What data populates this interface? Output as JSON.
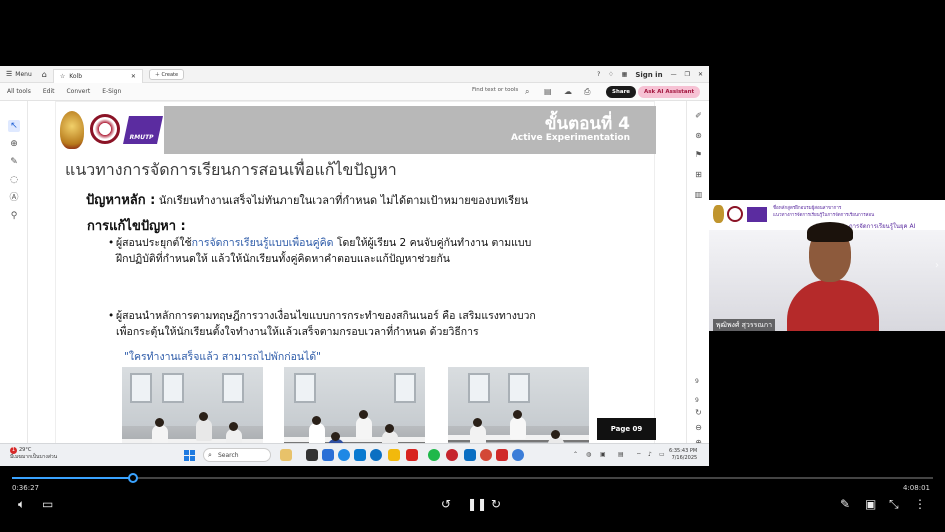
{
  "acrobat": {
    "menu_label": "Menu",
    "tab_title": "Kolb",
    "create_label": "Create",
    "sign_in": "Sign in",
    "toolbar_items": [
      "All tools",
      "Edit",
      "Convert",
      "E-Sign"
    ],
    "find_placeholder": "Find text or tools",
    "share_label": "Share",
    "ai_label": "Ask AI Assistant"
  },
  "slide": {
    "banner_title": "ขั้นตอนที่ 4",
    "banner_subtitle": "Active Experimentation",
    "logo3_text": "RMUTP",
    "heading": "แนวทางการจัดการเรียนการสอนเพื่อแก้ไขปัญหา",
    "problem_label": "ปัญหาหลัก :",
    "problem_text": "นักเรียนทำงานเสร็จไม่ทันภายในเวลาที่กำหนด ไม่ได้ตามเป้าหมายของบทเรียน",
    "solution_title": "การแก้ไขปัญหา :",
    "bullet1_a": "ผู้สอนประยุกต์ใช้",
    "bullet1_hl": "การจัดการเรียนรู้แบบเพื่อนคู่คิด",
    "bullet1_b": " โดยให้ผู้เรียน 2 คนจับคู่กันทำงาน ตามแบบ",
    "bullet1_line2": "ฝึกปฏิบัติที่กำหนดให้ แล้วให้นักเรียนทั้งคู่คิดหาคำตอบและแก้ปัญหาช่วยกัน",
    "bullet2_line1": "ผู้สอนนำหลักการตามทฤษฎีการวางเงื่อนไขแบบการกระทำของสกินเนอร์ คือ เสริมแรงทางบวก",
    "bullet2_line2": "เพื่อกระตุ้นให้นักเรียนตั้งใจทำงานให้แล้วเสร็จตามกรอบเวลาที่กำหนด ด้วยวิธีการ",
    "quote": "\"ใครทำงานเสร็จแล้ว สามารถไปพักก่อนได้\"",
    "page_label": "Page 09"
  },
  "rightbar": {
    "page_current": "9",
    "page_total": "9"
  },
  "taskbar": {
    "weather_badge": "1",
    "weather_temp": "29°C",
    "weather_desc": "มีเมฆมากเป็นบางส่วน",
    "search_label": "Search",
    "time": "6:35:43 PM",
    "date": "7/16/2025"
  },
  "presenter": {
    "banner_line1": "ชื่อหลักสูตรฝึกอบรมผู้สอนสาขาการ",
    "banner_line2": "แนวทางการจัดการเรียนรู้ในการจัดการเรียนการสอน",
    "banner_line3": "การจัดการเรียนรู้ในยุค AI",
    "name": "พุฒิพงศ์ สุวรรณกา"
  },
  "player": {
    "elapsed": "0:36:27",
    "duration": "4:08:01",
    "progress_fraction": 0.131,
    "accent_color": "#3aa3ff"
  }
}
